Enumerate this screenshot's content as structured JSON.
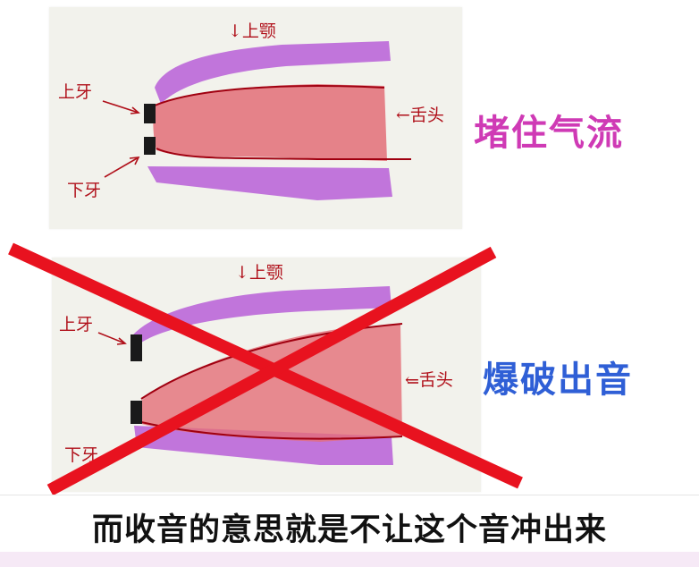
{
  "top_diagram": {
    "labels": {
      "upper_palate": "↓上颚",
      "upper_teeth": "上牙",
      "lower_teeth": "下牙",
      "tongue": "←舌头"
    },
    "caption": "堵住气流"
  },
  "bottom_diagram": {
    "labels": {
      "upper_palate": "↓上颚",
      "upper_teeth": "上牙",
      "lower_teeth": "下牙",
      "tongue": "←舌头"
    },
    "caption": "爆破出音",
    "crossed_out": true
  },
  "subtitle": "而收音的意思就是不让这个音冲出来",
  "colors": {
    "palate_purple": "#b95fd8",
    "tongue_red": "#e36e78",
    "teeth_black": "#1a1a1a",
    "cross_red": "#e8121f",
    "caption_top": "#cf3ab5",
    "caption_bottom": "#2f5fd6"
  }
}
